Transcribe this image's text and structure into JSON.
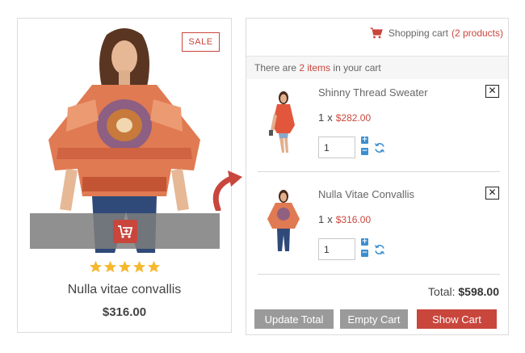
{
  "product": {
    "badge": "SALE",
    "name": "Nulla vitae convallis",
    "price": "$316.00",
    "rating": 5,
    "rating_max": 5,
    "icons": [
      "cart-plus-icon",
      "star-icon"
    ]
  },
  "cart": {
    "header_label": "Shopping cart",
    "header_count": "(2 products)",
    "info_prefix": "There are",
    "info_count": "2 items",
    "info_suffix": "in your cart",
    "items": [
      {
        "name": "Shinny Thread Sweater",
        "qty_prefix": "1",
        "qty_sep": "x",
        "price": "$282.00",
        "qty_value": "1"
      },
      {
        "name": "Nulla Vitae Convallis",
        "qty_prefix": "1",
        "qty_sep": "x",
        "price": "$316.00",
        "qty_value": "1"
      }
    ],
    "total_label": "Total:",
    "total_value": "$598.00",
    "buttons": {
      "update": "Update Total",
      "empty": "Empty Cart",
      "show": "Show Cart"
    }
  },
  "colors": {
    "accent": "#c9463d",
    "stepper": "#3b8fd0",
    "button_gray": "#9a9a9a",
    "star": "#f5b82e"
  }
}
